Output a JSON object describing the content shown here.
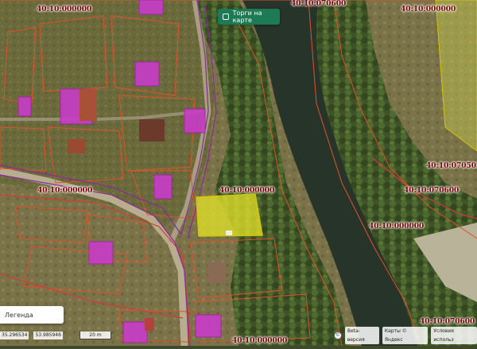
{
  "map": {
    "cadastral_labels": [
      {
        "id": "q1",
        "text": "40:10:000000"
      },
      {
        "id": "q2",
        "text": "40:10:070600"
      },
      {
        "id": "q3",
        "text": "40:10:000000"
      },
      {
        "id": "q4",
        "text": "40:10:070503"
      },
      {
        "id": "q5",
        "text": "40:10:000000"
      },
      {
        "id": "q6",
        "text": "40:10:000000"
      },
      {
        "id": "q7",
        "text": "40:10:070600"
      },
      {
        "id": "q8",
        "text": "40:10:000000"
      },
      {
        "id": "q9",
        "text": "40:10:070600"
      },
      {
        "id": "q10",
        "text": "40:10:000000"
      }
    ],
    "highlight_color": "#e6e62a",
    "building_color": "#c83cc8",
    "boundary_color": "#e0522a"
  },
  "controls": {
    "torgi_label": "Торги на карте",
    "legend_label": "Легенда",
    "coord_x": "35.296534",
    "coord_y": "53.985946",
    "scale_label": "20 m",
    "beta_label": "Beta-версия",
    "maps_label": "Карты © Яндекс",
    "terms_label": "Условия использ"
  }
}
